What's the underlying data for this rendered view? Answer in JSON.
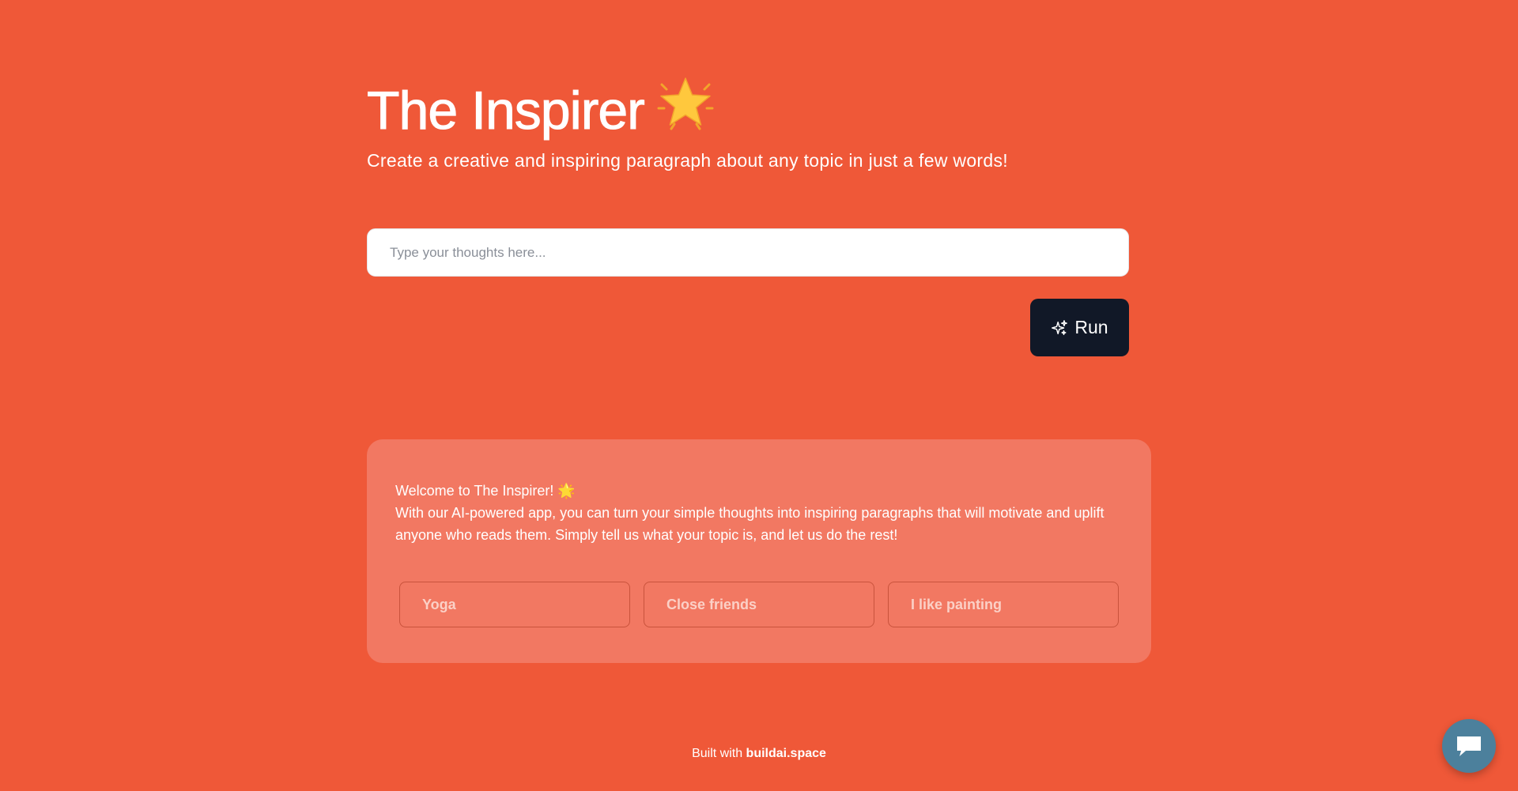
{
  "header": {
    "title": "The Inspirer",
    "title_emoji": "star-icon",
    "subtitle": "Create a creative and inspiring paragraph about any topic in just a few words!"
  },
  "prompt": {
    "placeholder": "Type your thoughts here...",
    "value": ""
  },
  "run_button": {
    "label": "Run",
    "icon": "sparkles-icon"
  },
  "card": {
    "welcome": "Welcome to The Inspirer! 🌟",
    "body": "With our AI-powered app, you can turn your simple thoughts into inspiring paragraphs that will motivate and uplift anyone who reads them. Simply tell us what your topic is, and let us do the rest!",
    "examples": [
      "Yoga",
      "Close friends",
      "I like painting"
    ]
  },
  "footer": {
    "prefix": "Built with",
    "link_label": "buildai.space"
  },
  "chat_widget": {
    "icon": "chat-bubble-icon"
  },
  "colors": {
    "background": "#EF5838",
    "card": "#F27862",
    "button": "#111827",
    "chat_fab": "#4C809C",
    "star": "#FFC83D"
  }
}
